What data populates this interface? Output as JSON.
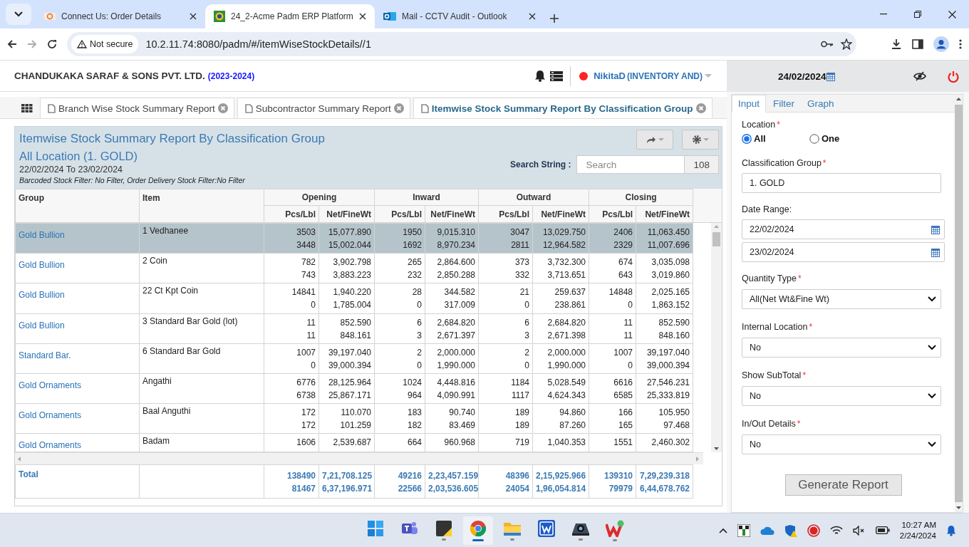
{
  "browser": {
    "tabs": [
      {
        "title": "Connect Us: Order Details",
        "selected": false
      },
      {
        "title": "24_2-Acme Padm ERP Platform",
        "selected": true
      },
      {
        "title": "Mail - CCTV Audit - Outlook",
        "selected": false
      }
    ],
    "security": "Not secure",
    "url": "10.2.11.74:8080/padm/#/itemWiseStockDetails//1"
  },
  "header": {
    "company": "CHANDUKAKA SARAF & SONS PVT. LTD.",
    "year": "(2023-2024)",
    "user": "NikitaD",
    "role": "(INVENTORY AND)",
    "date": "24/02/2024"
  },
  "report_tabs": [
    {
      "title": "Branch Wise Stock Summary Report",
      "selected": false
    },
    {
      "title": "Subcontractor Summary Report",
      "selected": false
    },
    {
      "title": "Itemwise Stock Summary Report By Classification Group",
      "selected": true
    }
  ],
  "report": {
    "title": "Itemwise Stock Summary Report By Classification Group",
    "location": "All Location (1. GOLD)",
    "period": "22/02/2024 To 23/02/2024",
    "filters": "Barcoded Stock Filter: No Filter, Order Delivery Stock Filter:No Filter",
    "search_label": "Search String :",
    "search_placeholder": "Search",
    "count": "108"
  },
  "table": {
    "columns": [
      "Group",
      "Item"
    ],
    "groups": [
      "Opening",
      "Inward",
      "Outward",
      "Closing"
    ],
    "subcolumns": [
      "Pcs/Lbl",
      "Net/FineWt",
      "Pcs/Lbl",
      "Net/FineWt",
      "Pcs/Lbl",
      "Net/FineWt",
      "Pcs/Lbl",
      "Net/FineWt"
    ],
    "rows": [
      {
        "group": "Gold Bullion",
        "item": "1 Vedhanee",
        "selected": true,
        "lines": [
          [
            "3503",
            "15,077.890",
            "1950",
            "9,015.310",
            "3047",
            "13,029.750",
            "2406",
            "11,063.450"
          ],
          [
            "3448",
            "15,002.044",
            "1692",
            "8,970.234",
            "2811",
            "12,964.582",
            "2329",
            "11,007.696"
          ]
        ]
      },
      {
        "group": "Gold Bullion",
        "item": "2 Coin",
        "selected": false,
        "lines": [
          [
            "782",
            "3,902.798",
            "265",
            "2,864.600",
            "373",
            "3,732.300",
            "674",
            "3,035.098"
          ],
          [
            "743",
            "3,883.223",
            "232",
            "2,850.288",
            "332",
            "3,713.651",
            "643",
            "3,019.860"
          ]
        ]
      },
      {
        "group": "Gold Bullion",
        "item": "22 Ct Kpt Coin",
        "selected": false,
        "lines": [
          [
            "14841",
            "1,940.220",
            "28",
            "344.582",
            "21",
            "259.637",
            "14848",
            "2,025.165"
          ],
          [
            "0",
            "1,785.004",
            "0",
            "317.009",
            "0",
            "238.861",
            "0",
            "1,863.152"
          ]
        ]
      },
      {
        "group": "Gold Bullion",
        "item": "3 Standard Bar Gold (lot)",
        "selected": false,
        "lines": [
          [
            "11",
            "852.590",
            "6",
            "2,684.820",
            "6",
            "2,684.820",
            "11",
            "852.590"
          ],
          [
            "11",
            "848.161",
            "3",
            "2,671.397",
            "3",
            "2,671.398",
            "11",
            "848.160"
          ]
        ]
      },
      {
        "group": "Standard Bar.",
        "item": "6 Standard Bar Gold",
        "selected": false,
        "lines": [
          [
            "1007",
            "39,197.040",
            "2",
            "2,000.000",
            "2",
            "2,000.000",
            "1007",
            "39,197.040"
          ],
          [
            "0",
            "39,000.394",
            "0",
            "1,990.000",
            "0",
            "1,990.000",
            "0",
            "39,000.394"
          ]
        ]
      },
      {
        "group": "Gold Ornaments",
        "item": "Angathi",
        "selected": false,
        "lines": [
          [
            "6776",
            "28,125.964",
            "1024",
            "4,448.816",
            "1184",
            "5,028.549",
            "6616",
            "27,546.231"
          ],
          [
            "6738",
            "25,867.171",
            "964",
            "4,090.991",
            "1117",
            "4,624.343",
            "6585",
            "25,333.819"
          ]
        ]
      },
      {
        "group": "Gold Ornaments",
        "item": "Baal Anguthi",
        "selected": false,
        "lines": [
          [
            "172",
            "110.070",
            "183",
            "90.740",
            "189",
            "94.860",
            "166",
            "105.950"
          ],
          [
            "172",
            "101.259",
            "182",
            "83.469",
            "189",
            "87.260",
            "165",
            "97.468"
          ]
        ]
      },
      {
        "group": "Gold Ornaments",
        "item": "Badam",
        "selected": false,
        "lines": [
          [
            "1606",
            "2,539.687",
            "664",
            "960.968",
            "719",
            "1,040.353",
            "1551",
            "2,460.302"
          ]
        ]
      }
    ],
    "total": {
      "label": "Total",
      "lines": [
        [
          "138490",
          "7,21,708.125",
          "49216",
          "2,23,457.159",
          "48396",
          "2,15,925.966",
          "139310",
          "7,29,239.318"
        ],
        [
          "81467",
          "6,37,196.971",
          "22566",
          "2,03,536.605",
          "24054",
          "1,96,054.814",
          "79979",
          "6,44,678.762"
        ]
      ]
    }
  },
  "panel": {
    "tabs": [
      {
        "label": "Input",
        "selected": true
      },
      {
        "label": "Filter",
        "selected": false
      },
      {
        "label": "Graph",
        "selected": false
      }
    ],
    "fields": [
      {
        "kind": "radio",
        "label": "Location",
        "mark": "*",
        "options": [
          {
            "label": "All",
            "selected": true
          },
          {
            "label": "One",
            "selected": false
          }
        ]
      },
      {
        "kind": "text",
        "label": "Classification Group",
        "mark": "*",
        "value": "1. GOLD"
      },
      {
        "kind": "dates",
        "label": "Date Range:",
        "values": [
          "22/02/2024",
          "23/02/2024"
        ]
      },
      {
        "kind": "select",
        "label": "Quantity Type",
        "mark": "*",
        "value": "All(Net Wt&Fine Wt)"
      },
      {
        "kind": "select",
        "label": "Internal Location",
        "mark": "*",
        "value": "No"
      },
      {
        "kind": "select",
        "label": "Show SubTotal",
        "mark": "*",
        "value": "No"
      },
      {
        "kind": "select",
        "label": "In/Out Details",
        "mark": "*",
        "value": "No"
      }
    ],
    "button": "Generate Report"
  },
  "taskbar": {
    "apps": [
      {
        "kind": "start",
        "running": false,
        "selected": false
      },
      {
        "kind": "teams",
        "running": false,
        "selected": false
      },
      {
        "kind": "notes",
        "running": true,
        "selected": false
      },
      {
        "kind": "chrome",
        "running": true,
        "selected": true
      },
      {
        "kind": "folder",
        "running": true,
        "selected": false
      },
      {
        "kind": "writer",
        "running": false,
        "selected": false
      },
      {
        "kind": "camera",
        "running": true,
        "selected": false
      },
      {
        "kind": "office",
        "running": true,
        "selected": false
      }
    ],
    "time": "10:27 AM",
    "date": "2/24/2024"
  }
}
